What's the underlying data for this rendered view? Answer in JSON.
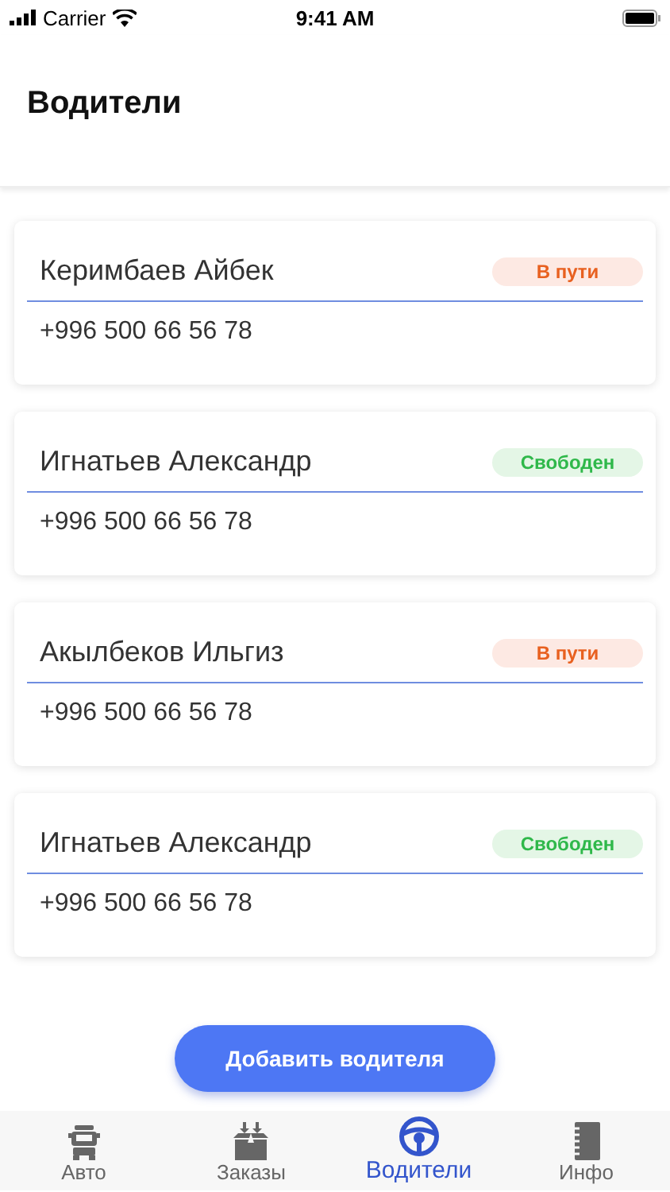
{
  "status_bar": {
    "carrier": "Carrier",
    "time": "9:41 AM"
  },
  "title": "Водители",
  "drivers": [
    {
      "name": "Керимбаев Айбек",
      "phone": "+996 500 66 56 78",
      "status": {
        "label": "В пути",
        "kind": "busy"
      }
    },
    {
      "name": "Игнатьев Александр",
      "phone": "+996 500 66 56 78",
      "status": {
        "label": "Свободен",
        "kind": "free"
      }
    },
    {
      "name": "Акылбеков Ильгиз",
      "phone": "+996 500 66 56 78",
      "status": {
        "label": "В пути",
        "kind": "busy"
      }
    },
    {
      "name": "Игнатьев Александр",
      "phone": "+996 500 66 56 78",
      "status": {
        "label": "Свободен",
        "kind": "free"
      }
    }
  ],
  "add_button": "Добавить водителя",
  "tabs": [
    {
      "label": "Авто",
      "selected": false
    },
    {
      "label": "Заказы",
      "selected": false
    },
    {
      "label": "Водители",
      "selected": true
    },
    {
      "label": "Инфо",
      "selected": false
    }
  ]
}
